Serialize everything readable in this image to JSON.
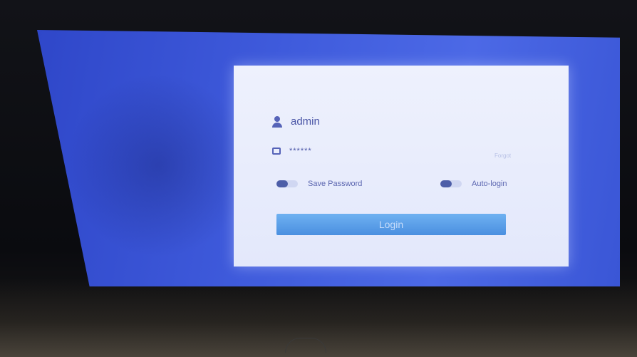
{
  "login": {
    "username": "admin",
    "password_mask": "******",
    "forgot_link": "Forgot",
    "save_password_label": "Save Password",
    "auto_login_label": "Auto-login",
    "login_button": "Login"
  },
  "icons": {
    "username_icon": "user-icon",
    "password_icon": "lock-icon"
  },
  "colors": {
    "screen_background": "#3f5bdc",
    "panel_background": "#e9edfc",
    "login_button": "#5aa0ea",
    "toggle_on": "#4d5ea8"
  },
  "toggles": {
    "save_password_on": true,
    "auto_login_on": true
  }
}
